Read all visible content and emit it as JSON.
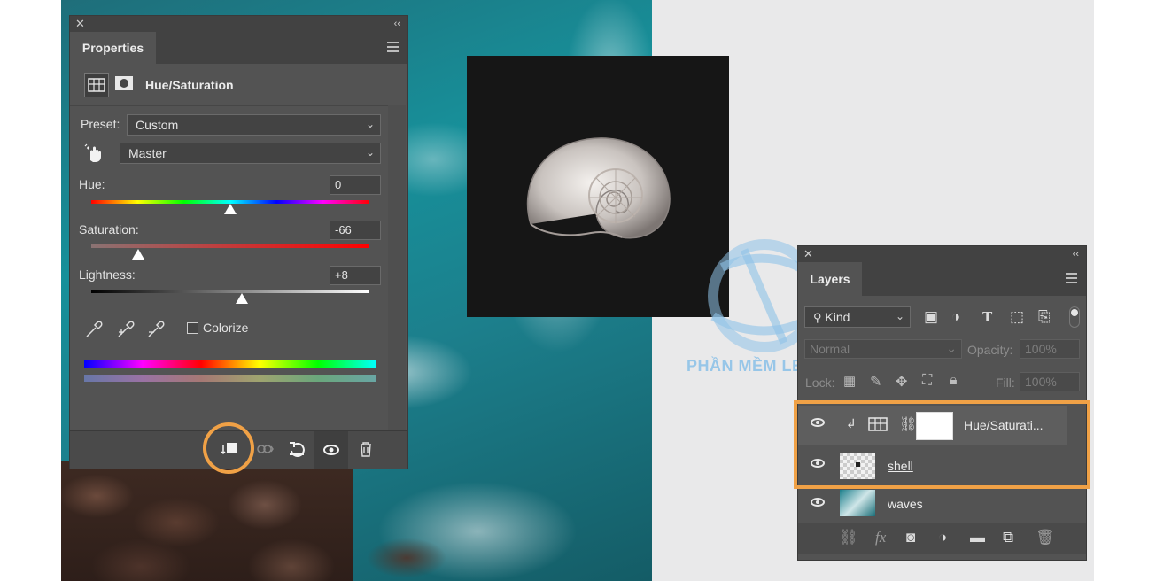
{
  "properties_panel": {
    "tab_label": "Properties",
    "adjustment_title": "Hue/Saturation",
    "preset_label": "Preset:",
    "preset_value": "Custom",
    "channel_value": "Master",
    "hue": {
      "label": "Hue:",
      "value": "0",
      "position": 0.5
    },
    "saturation": {
      "label": "Saturation:",
      "value": "-66",
      "position": 0.17
    },
    "lightness": {
      "label": "Lightness:",
      "value": "+8",
      "position": 0.54
    },
    "colorize_label": "Colorize",
    "colorize_checked": false
  },
  "layers_panel": {
    "tab_label": "Layers",
    "filter_kind": "Kind",
    "blend_mode": "Normal",
    "opacity_label": "Opacity:",
    "opacity_value": "100%",
    "lock_label": "Lock:",
    "fill_label": "Fill:",
    "fill_value": "100%",
    "layers": [
      {
        "name": "Hue/Saturati...",
        "visible": true,
        "clipped": true,
        "type": "adjustment"
      },
      {
        "name": "shell",
        "visible": true,
        "type": "pixel"
      },
      {
        "name": "waves",
        "visible": true,
        "type": "pixel"
      }
    ]
  },
  "watermark": {
    "text": "PHẦN MỀM LEGIT"
  },
  "colors": {
    "highlight": "#f0a146",
    "panel": "#535353",
    "panel_dark": "#424242"
  }
}
